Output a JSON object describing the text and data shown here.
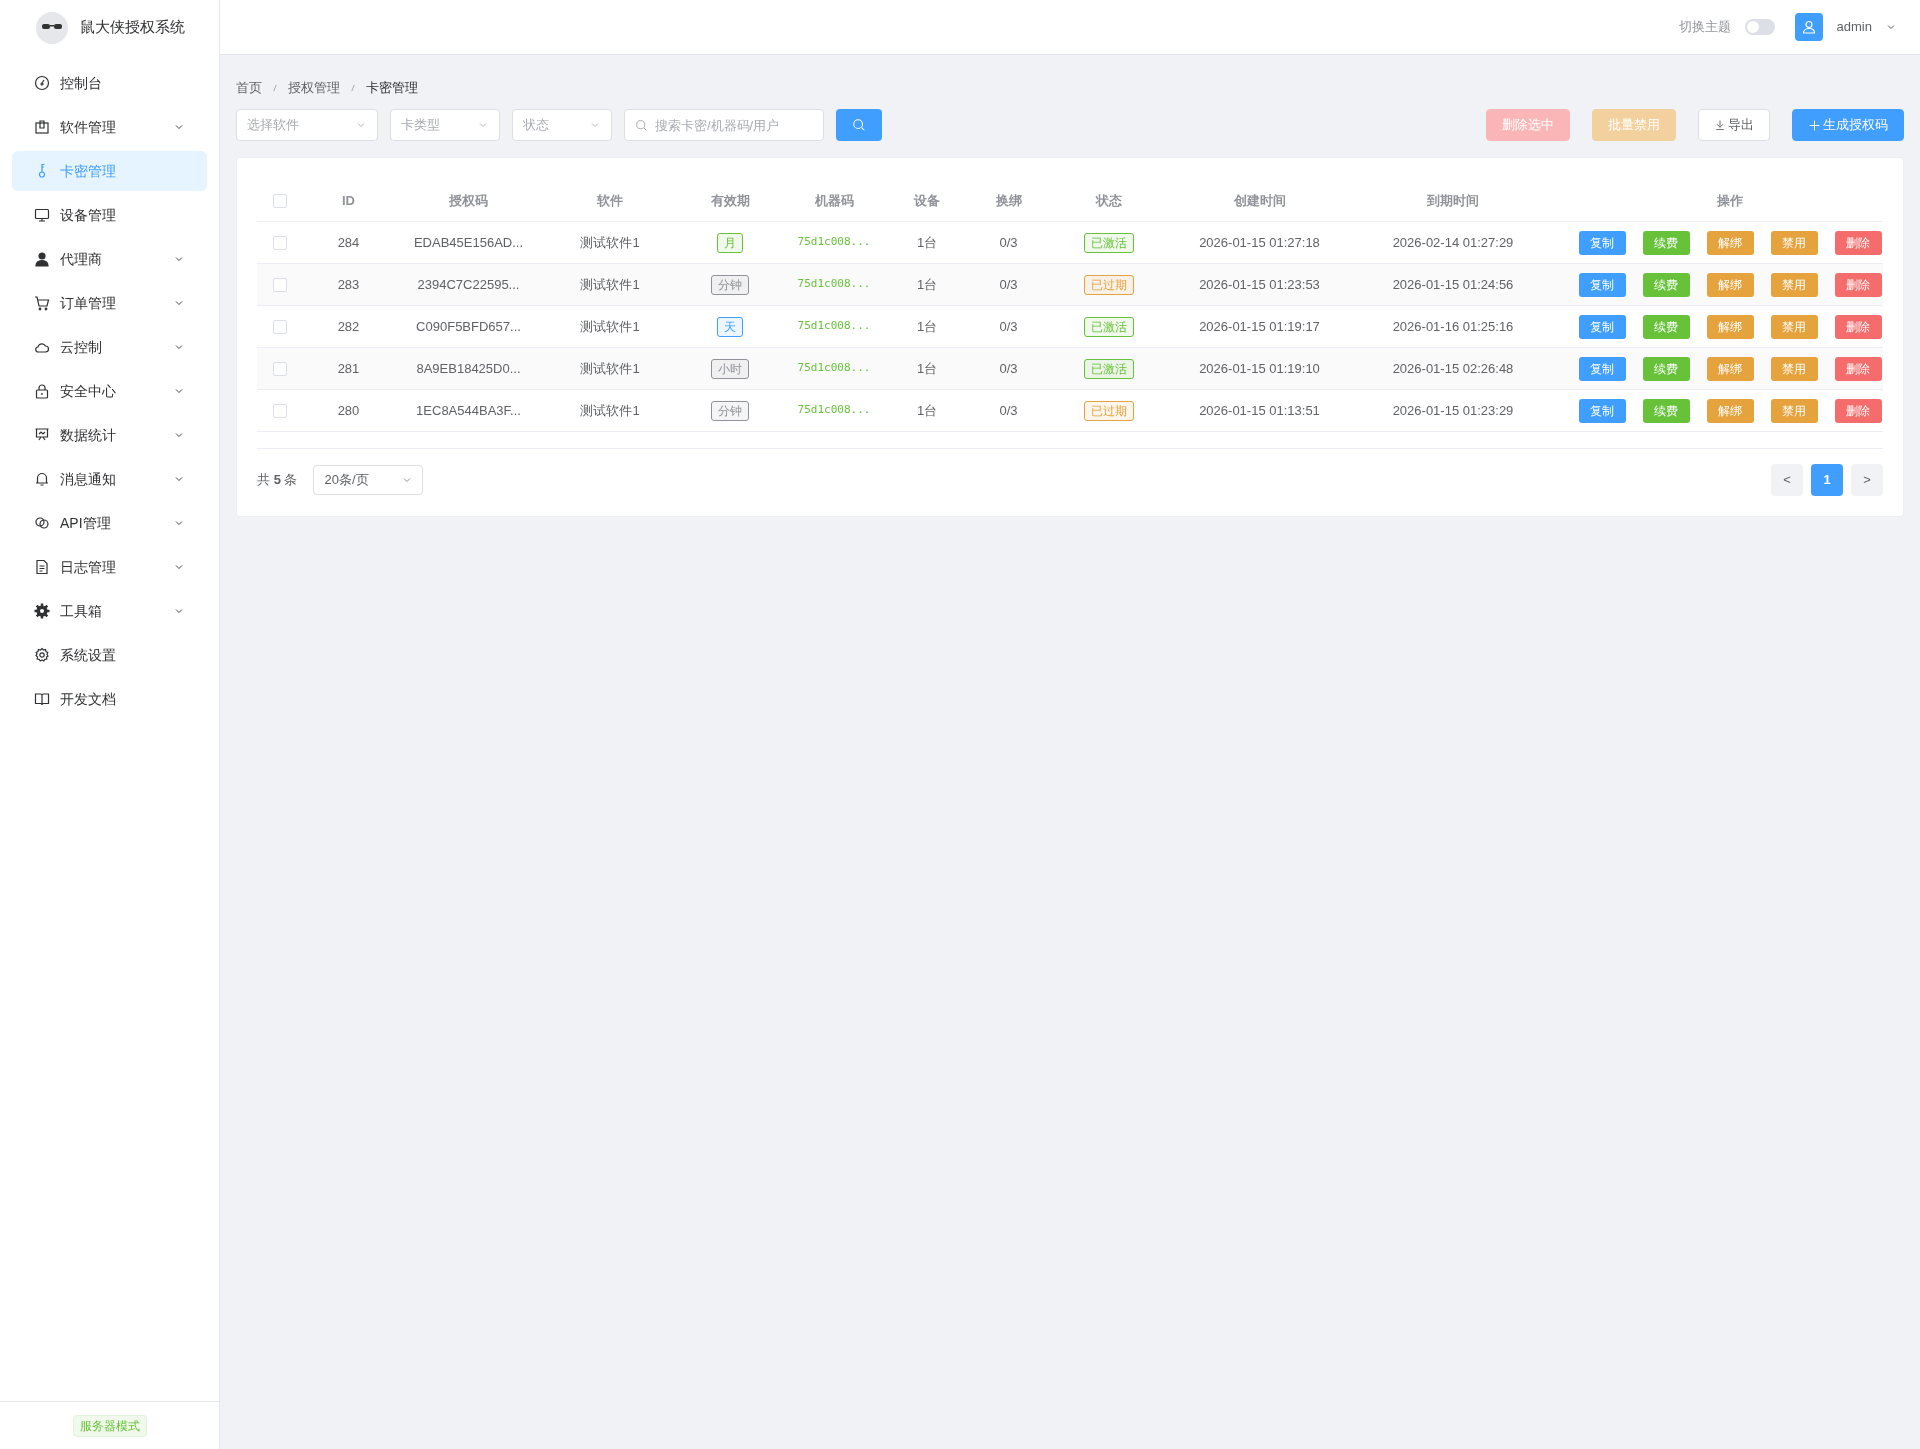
{
  "brand": {
    "title": "鼠大侠授权系统"
  },
  "sidebar": {
    "items": [
      {
        "label": "控制台",
        "kind": "link",
        "selected": false
      },
      {
        "label": "软件管理",
        "kind": "group",
        "selected": false
      },
      {
        "label": "卡密管理",
        "kind": "link",
        "selected": true
      },
      {
        "label": "设备管理",
        "kind": "link",
        "selected": false
      },
      {
        "label": "代理商",
        "kind": "group",
        "selected": false
      },
      {
        "label": "订单管理",
        "kind": "group",
        "selected": false
      },
      {
        "label": "云控制",
        "kind": "group",
        "selected": false
      },
      {
        "label": "安全中心",
        "kind": "group",
        "selected": false
      },
      {
        "label": "数据统计",
        "kind": "group",
        "selected": false
      },
      {
        "label": "消息通知",
        "kind": "group",
        "selected": false
      },
      {
        "label": "API管理",
        "kind": "group",
        "selected": false
      },
      {
        "label": "日志管理",
        "kind": "group",
        "selected": false
      },
      {
        "label": "工具箱",
        "kind": "group",
        "selected": false
      },
      {
        "label": "系统设置",
        "kind": "link",
        "selected": false
      },
      {
        "label": "开发文档",
        "kind": "link",
        "selected": false
      }
    ],
    "footer_badge": "服务器模式"
  },
  "header": {
    "theme_label": "切换主题",
    "theme_toggle": {
      "on": false
    },
    "user": "admin"
  },
  "breadcrumb": [
    "首页",
    "授权管理",
    "卡密管理"
  ],
  "filters": {
    "selects": [
      {
        "placeholder": "选择软件"
      },
      {
        "placeholder": "卡类型"
      },
      {
        "placeholder": "状态"
      }
    ],
    "search": {
      "placeholder": "搜索卡密/机器码/用户"
    }
  },
  "toolbar_buttons": [
    {
      "label": "删除选中",
      "kind": "danger",
      "disabled": true
    },
    {
      "label": "批量禁用",
      "kind": "warning",
      "disabled": true
    },
    {
      "label": "导出",
      "kind": "export",
      "disabled": false
    },
    {
      "label": "生成授权码",
      "kind": "primary",
      "disabled": false
    }
  ],
  "table": {
    "header_checkbox": {
      "checked": false
    },
    "columns": [
      "ID",
      "授权码",
      "软件",
      "有效期",
      "机器码",
      "设备",
      "换绑",
      "状态",
      "创建时间",
      "到期时间",
      "操作"
    ],
    "rows": [
      {
        "checked": false,
        "id": "284",
        "code": "EDAB45E156AD...",
        "software": "测试软件1",
        "period": {
          "text": "月",
          "color": "#67c23a"
        },
        "machine": "75d1c008...",
        "device": "1台",
        "rebind": "0/3",
        "status": {
          "text": "已激活",
          "color": "#67c23a"
        },
        "created": "2026-01-15 01:27:18",
        "expires": "2026-02-14 01:27:29",
        "actions": [
          "复制",
          "续费",
          "解绑",
          "禁用",
          "删除"
        ]
      },
      {
        "checked": false,
        "id": "283",
        "code": "2394C7C22595...",
        "software": "测试软件1",
        "period": {
          "text": "分钟",
          "color": "#909399"
        },
        "machine": "75d1c008...",
        "device": "1台",
        "rebind": "0/3",
        "status": {
          "text": "已过期",
          "color": "#e6a23c"
        },
        "created": "2026-01-15 01:23:53",
        "expires": "2026-01-15 01:24:56",
        "actions": [
          "复制",
          "续费",
          "解绑",
          "禁用",
          "删除"
        ]
      },
      {
        "checked": false,
        "id": "282",
        "code": "C090F5BFD657...",
        "software": "测试软件1",
        "period": {
          "text": "天",
          "color": "#409eff"
        },
        "machine": "75d1c008...",
        "device": "1台",
        "rebind": "0/3",
        "status": {
          "text": "已激活",
          "color": "#67c23a"
        },
        "created": "2026-01-15 01:19:17",
        "expires": "2026-01-16 01:25:16",
        "actions": [
          "复制",
          "续费",
          "解绑",
          "禁用",
          "删除"
        ]
      },
      {
        "checked": false,
        "id": "281",
        "code": "8A9EB18425D0...",
        "software": "测试软件1",
        "period": {
          "text": "小时",
          "color": "#909399"
        },
        "machine": "75d1c008...",
        "device": "1台",
        "rebind": "0/3",
        "status": {
          "text": "已激活",
          "color": "#67c23a"
        },
        "created": "2026-01-15 01:19:10",
        "expires": "2026-01-15 02:26:48",
        "actions": [
          "复制",
          "续费",
          "解绑",
          "禁用",
          "删除"
        ]
      },
      {
        "checked": false,
        "id": "280",
        "code": "1EC8A544BA3F...",
        "software": "测试软件1",
        "period": {
          "text": "分钟",
          "color": "#909399"
        },
        "machine": "75d1c008...",
        "device": "1台",
        "rebind": "0/3",
        "status": {
          "text": "已过期",
          "color": "#e6a23c"
        },
        "created": "2026-01-15 01:13:51",
        "expires": "2026-01-15 01:23:29",
        "actions": [
          "复制",
          "续费",
          "解绑",
          "禁用",
          "删除"
        ]
      }
    ]
  },
  "pagination": {
    "total": "共 **5** 条",
    "page_size": "20条/页",
    "prev": "<",
    "pages": [
      {
        "label": "1",
        "selected": true
      }
    ],
    "next": ">"
  }
}
